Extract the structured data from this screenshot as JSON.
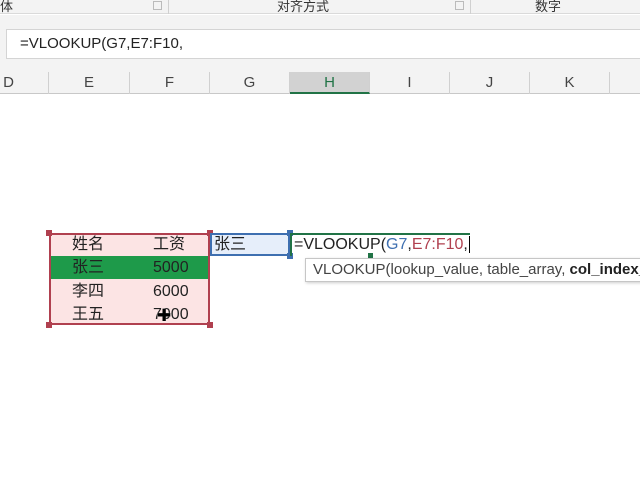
{
  "ribbon": {
    "groups": [
      "体",
      "对齐方式",
      "数字"
    ]
  },
  "formula_bar": {
    "value": "=VLOOKUP(G7,E7:F10,"
  },
  "columns": [
    "D",
    "E",
    "F",
    "G",
    "H",
    "I",
    "J",
    "K"
  ],
  "selected_column": "H",
  "table": {
    "headers": [
      "姓名",
      "工资"
    ],
    "rows": [
      [
        "张三",
        "5000"
      ],
      [
        "李四",
        "6000"
      ],
      [
        "王五",
        "7000"
      ]
    ]
  },
  "lookup_cell": "张三",
  "edit_cell": {
    "prefix": "=VLOOKUP(",
    "ref1": "G7",
    "sep1": ",",
    "ref2": "E7:F10",
    "sep2": ","
  },
  "tooltip": {
    "text": "VLOOKUP(lookup_value, table_array, ",
    "bold": "col_index_num"
  },
  "colors": {
    "accent": "#217346",
    "highlight": "#1e9a4a",
    "range_border": "#b0404f",
    "range_fill": "#fce4e4",
    "ref1": "#3e6fb0",
    "ref2": "#b0404f"
  }
}
